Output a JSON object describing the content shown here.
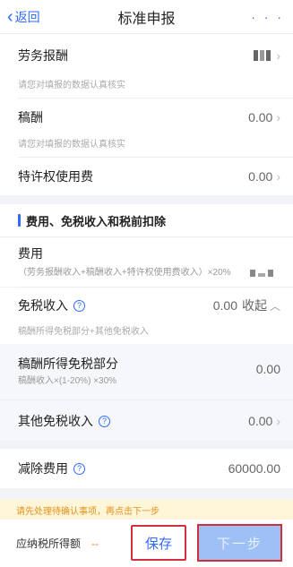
{
  "nav": {
    "back_label": "返回",
    "title": "标准申报",
    "more_label": "· · ·"
  },
  "income": {
    "labor": {
      "label": "劳务报酬",
      "hint": "请您对填报的数据认真核实"
    },
    "royalty": {
      "label": "稿酬",
      "value": "0.00",
      "hint": "请您对填报的数据认真核实"
    },
    "franchise": {
      "label": "特许权使用费",
      "value": "0.00"
    }
  },
  "section": {
    "title": "费用、免税收入和税前扣除"
  },
  "fee": {
    "label": "费用",
    "formula": "（劳务报酬收入+稿酬收入+特许权使用费收入）×20%"
  },
  "exempt": {
    "label": "免税收入",
    "value": "0.00",
    "toggle_label": "收起",
    "formula": "稿酬所得免税部分+其他免税收入"
  },
  "royalty_exempt": {
    "label": "稿酬所得免税部分",
    "formula": "稿酬收入×(1-20%) ×30%",
    "value": "0.00"
  },
  "other_exempt": {
    "label": "其他免税收入",
    "value": "0.00"
  },
  "deduction": {
    "label": "减除费用",
    "value": "60000.00"
  },
  "warning": "请先处理待确认事项，再点击下一步",
  "footer": {
    "tax_label": "应纳税所得额",
    "tax_value": "--",
    "save_label": "保存",
    "next_label": "下一步"
  },
  "colors": {
    "accent": "#2f6bff",
    "warning_bg": "#fff5d8",
    "warning_text": "#e0921a",
    "highlight_border": "#d0303b"
  }
}
